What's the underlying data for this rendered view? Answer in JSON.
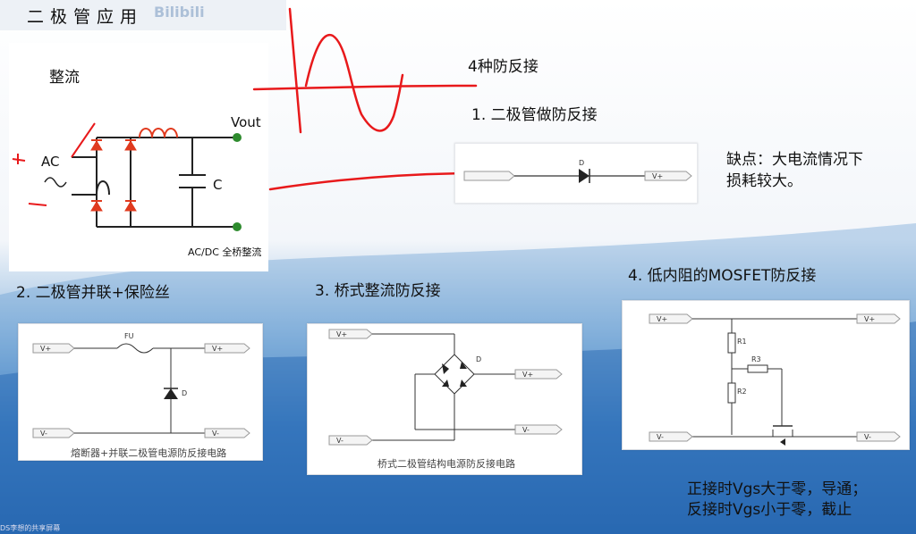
{
  "page_title": "二极管应用",
  "watermark": "Bilibili",
  "rectifier": {
    "label": "整流",
    "ac_label": "AC",
    "vout_label": "Vout",
    "c_label": "C",
    "caption": "AC/DC 全桥整流"
  },
  "methods_heading": "4种防反接",
  "method1": {
    "title": "1. 二极管做防反接",
    "d_label": "D",
    "vplus_label": "V+"
  },
  "drawback": {
    "line1": "缺点：大电流情况下",
    "line2": "损耗较大。"
  },
  "method2": {
    "title": "2. 二极管并联+保险丝",
    "fu_label": "FU",
    "d_label": "D",
    "vplus": "V+",
    "vminus": "V-",
    "caption": "熔断器+并联二极管电源防反接电路"
  },
  "method3": {
    "title": "3. 桥式整流防反接",
    "d_label": "D",
    "vplus": "V+",
    "vminus": "V-",
    "caption": "桥式二极管结构电源防反接电路"
  },
  "method4": {
    "title": "4. 低内阻的MOSFET防反接",
    "r1": "R1",
    "r2": "R2",
    "r3": "R3",
    "vplus": "V+",
    "vminus": "V-"
  },
  "mosfet_note": {
    "line1": "正接时Vgs大于零，导通；",
    "line2": "反接时Vgs小于零，截止"
  },
  "share_bar": "DS李想的共享屏幕",
  "colors": {
    "background_top": "#ffffff",
    "background_bottom": "#1d63b0",
    "annotation": "#e8191b",
    "diode": "#e03a1e",
    "node": "#2e8b2e"
  }
}
